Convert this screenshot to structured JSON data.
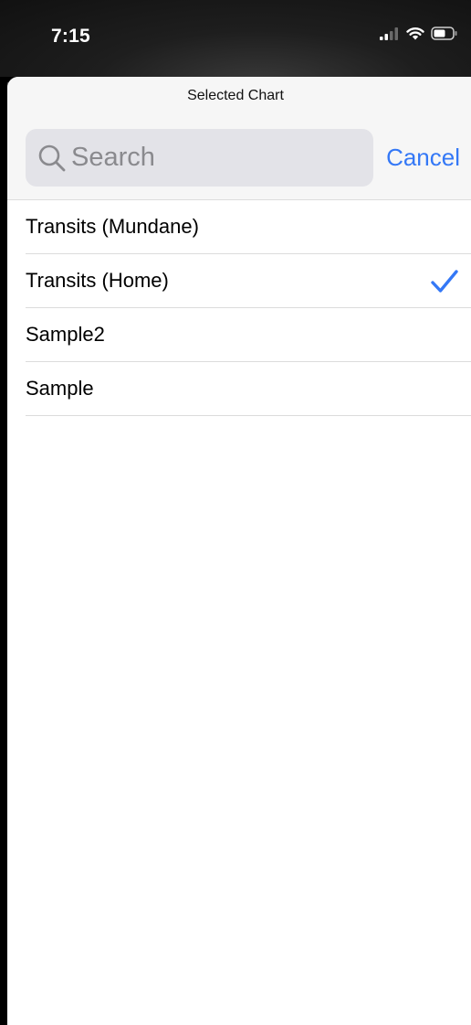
{
  "status_bar": {
    "time": "7:15"
  },
  "sheet": {
    "title": "Selected Chart",
    "search": {
      "placeholder": "Search"
    },
    "cancel_label": "Cancel"
  },
  "charts": [
    {
      "label": "Transits (Mundane)",
      "selected": false
    },
    {
      "label": "Transits (Home)",
      "selected": true
    },
    {
      "label": "Sample2",
      "selected": false
    },
    {
      "label": "Sample",
      "selected": false
    }
  ],
  "colors": {
    "accent": "#3478f6",
    "header_bg": "#f6f6f6",
    "search_bg": "#e3e3e8",
    "placeholder": "#8a8a8e",
    "separator": "#dcdcdc"
  },
  "icons": {
    "signal": "cellular-signal-icon",
    "wifi": "wifi-icon",
    "battery": "battery-icon",
    "search": "magnifier-search-icon",
    "selected": "checkmark-icon"
  }
}
